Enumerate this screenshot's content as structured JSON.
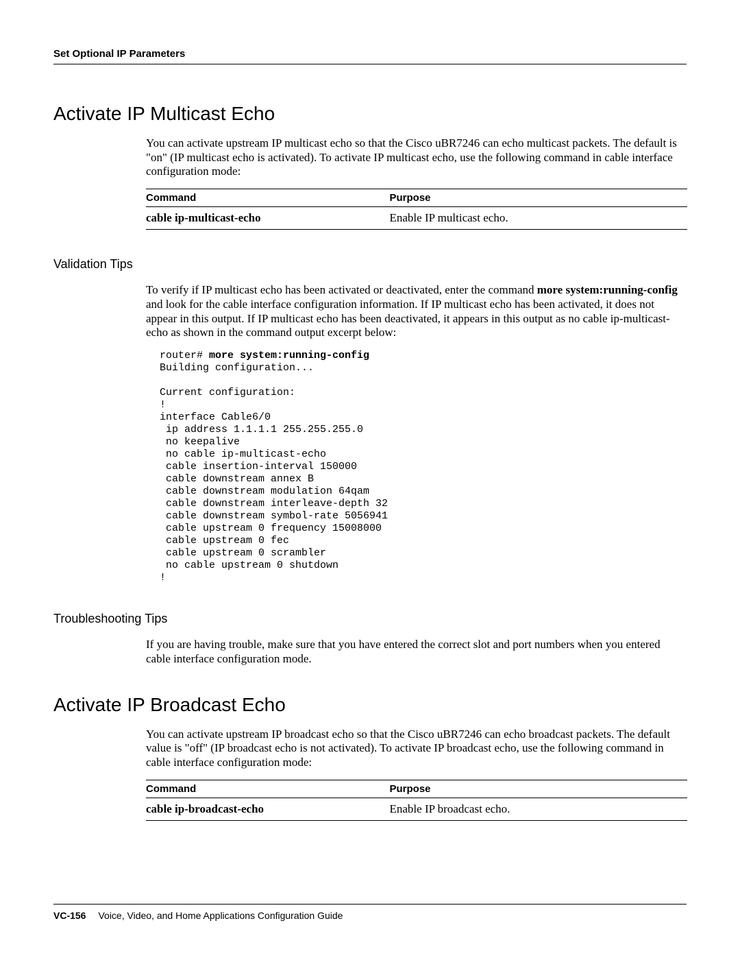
{
  "header": {
    "running_head": "Set Optional IP Parameters"
  },
  "section1": {
    "heading": "Activate IP Multicast Echo",
    "intro": "You can activate upstream IP multicast echo so that the Cisco uBR7246 can echo multicast packets. The default is \"on\" (IP multicast echo is activated). To activate IP multicast echo, use the following command in cable interface configuration mode:",
    "table": {
      "col1": "Command",
      "col2": "Purpose",
      "row_cmd": "cable ip-multicast-echo",
      "row_purpose": "Enable IP multicast echo."
    },
    "validation": {
      "heading": "Validation Tips",
      "para_pre": "To verify if IP multicast echo has been activated or deactivated, enter the command ",
      "para_bold": "more system:running-config",
      "para_post": " and look for the cable interface configuration information. If IP multicast echo has been activated, it does not appear in this output. If IP multicast echo has been deactivated, it appears in this output as no cable ip-multicast-echo as shown in the command output excerpt below:",
      "code_prompt": "router# ",
      "code_cmd": "more system:running-config",
      "code_body": "Building configuration...\n\nCurrent configuration:\n!\ninterface Cable6/0\n ip address 1.1.1.1 255.255.255.0\n no keepalive\n no cable ip-multicast-echo\n cable insertion-interval 150000\n cable downstream annex B\n cable downstream modulation 64qam\n cable downstream interleave-depth 32\n cable downstream symbol-rate 5056941\n cable upstream 0 frequency 15008000\n cable upstream 0 fec\n cable upstream 0 scrambler\n no cable upstream 0 shutdown\n!"
    },
    "troubleshooting": {
      "heading": "Troubleshooting Tips",
      "para": "If you are having trouble, make sure that you have entered the correct slot and port numbers when you entered cable interface configuration mode."
    }
  },
  "section2": {
    "heading": "Activate IP Broadcast Echo",
    "intro": "You can activate upstream IP broadcast echo so that the Cisco uBR7246 can echo broadcast packets. The default value is \"off\" (IP broadcast echo is not activated). To activate IP broadcast echo, use the following command in cable interface configuration mode:",
    "table": {
      "col1": "Command",
      "col2": "Purpose",
      "row_cmd": "cable ip-broadcast-echo",
      "row_purpose": "Enable IP broadcast echo."
    }
  },
  "footer": {
    "page_number": "VC-156",
    "doc_title": "Voice, Video, and Home Applications Configuration Guide"
  }
}
